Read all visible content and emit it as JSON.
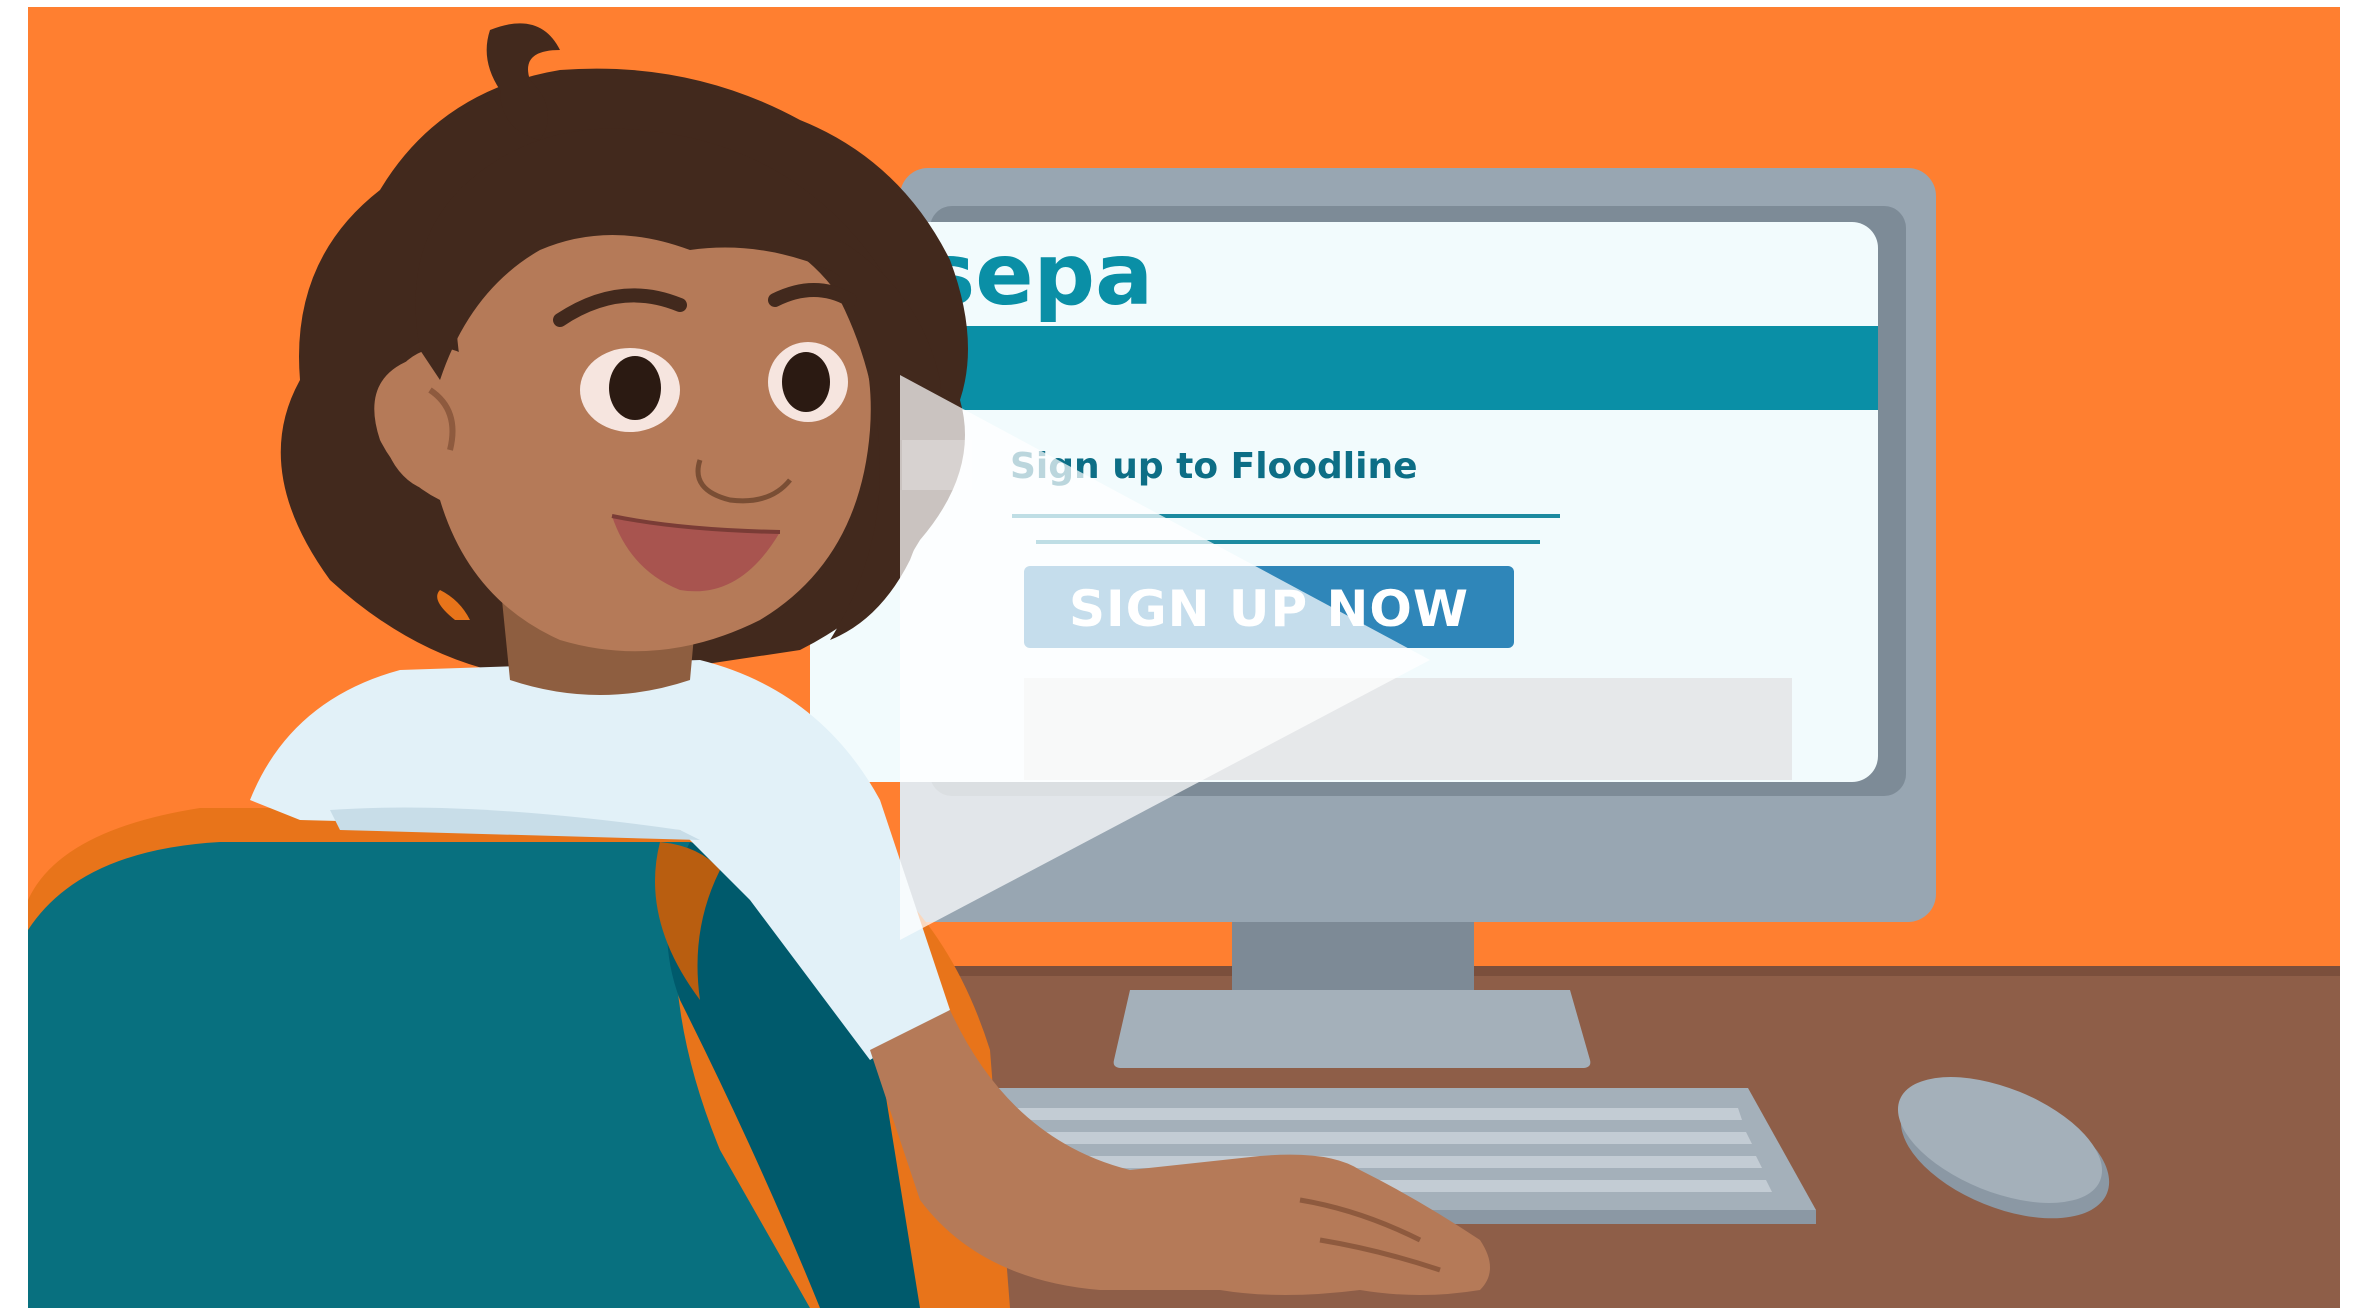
{
  "video": {
    "brand": "sepa",
    "screen_title": "Sign up to Floodline",
    "cta_label": "SIGN UP NOW",
    "play_button": "play-icon"
  },
  "colors": {
    "background": "#FF7F30",
    "desk": "#8E5E48",
    "brand_teal": "#0A8FA6",
    "button_blue": "#2F86B9",
    "chair": "#08707F",
    "chair_trim": "#E8741A",
    "monitor": "#98A6B2"
  }
}
